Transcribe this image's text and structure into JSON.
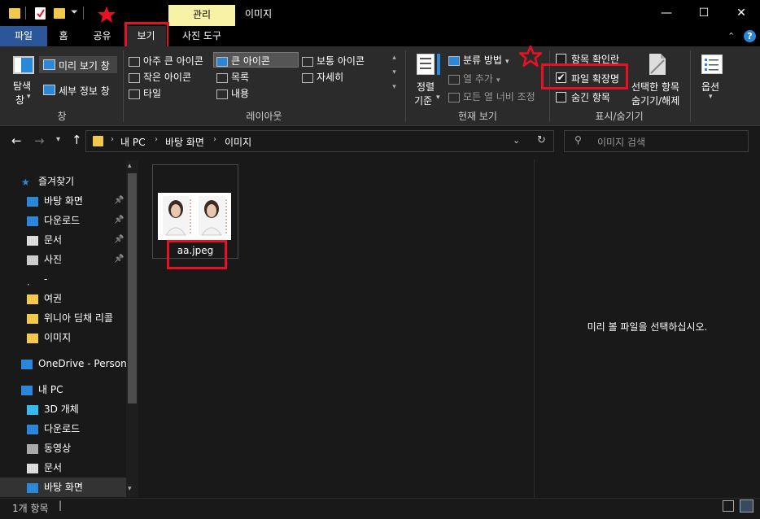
{
  "titlebar": {
    "manage_tab": "관리",
    "window_title": "이미지",
    "minimize": "—",
    "maximize": "☐",
    "close": "✕"
  },
  "ribbon_tabs": {
    "file": "파일",
    "home": "홈",
    "share": "공유",
    "view": "보기",
    "picture_tools": "사진 도구",
    "help": "?"
  },
  "ribbon": {
    "pane": {
      "nav_pane_line1": "탐색",
      "nav_pane_line2": "창",
      "preview_pane": "미리 보기 창",
      "details_pane": "세부 정보 창",
      "label": "창"
    },
    "layout": {
      "extra_large": "아주 큰 아이콘",
      "large": "큰 아이콘",
      "medium": "보통 아이콘",
      "small": "작은 아이콘",
      "list": "목록",
      "details": "자세히",
      "tiles": "타일",
      "content": "내용",
      "label": "레이아웃"
    },
    "current_view": {
      "sort_line1": "정렬",
      "sort_line2": "기준",
      "group_by": "분류 방법",
      "add_columns": "열 추가",
      "fit_columns": "모든 열 너비 조정",
      "label": "현재 보기"
    },
    "show_hide": {
      "item_checkboxes": "항목 확인란",
      "file_extensions": "파일 확장명",
      "hidden_items": "숨긴 항목",
      "hide_selected_line1": "선택한 항목",
      "hide_selected_line2": "숨기기/해제",
      "label": "표시/숨기기",
      "item_checkboxes_checked": false,
      "file_extensions_checked": true,
      "hidden_items_checked": false
    },
    "options": "옵션"
  },
  "address": {
    "crumbs": [
      "내 PC",
      "바탕 화면",
      "이미지"
    ],
    "search_placeholder": "이미지 검색"
  },
  "nav": {
    "items": [
      {
        "label": "즐겨찾기",
        "icon": "star-icon"
      },
      {
        "label": "바탕 화면",
        "icon": "desktop-icon"
      },
      {
        "label": "다운로드",
        "icon": "download-icon"
      },
      {
        "label": "문서",
        "icon": "document-icon"
      },
      {
        "label": "사진",
        "icon": "pictures-icon"
      },
      {
        "label": "-",
        "icon": "dot-icon"
      },
      {
        "label": "여권",
        "icon": "folder-icon"
      },
      {
        "label": "위니아 딤채 리콜",
        "icon": "folder-icon"
      },
      {
        "label": "이미지",
        "icon": "folder-icon"
      },
      {
        "label": "OneDrive - Persona",
        "icon": "cloud-icon"
      },
      {
        "label": "내 PC",
        "icon": "pc-icon"
      },
      {
        "label": "3D 개체",
        "icon": "cube-icon"
      },
      {
        "label": "다운로드",
        "icon": "download-icon"
      },
      {
        "label": "동영상",
        "icon": "video-icon"
      },
      {
        "label": "문서",
        "icon": "document-icon"
      },
      {
        "label": "바탕 화면",
        "icon": "desktop-icon"
      }
    ]
  },
  "content": {
    "file_name": "aa.jpeg",
    "preview_message": "미리 볼 파일을 선택하십시오."
  },
  "status": {
    "item_count": "1개 항목"
  },
  "colors": {
    "accent": "#2b579a",
    "highlight": "#e81123",
    "manage_tab": "#f7f2a6"
  }
}
